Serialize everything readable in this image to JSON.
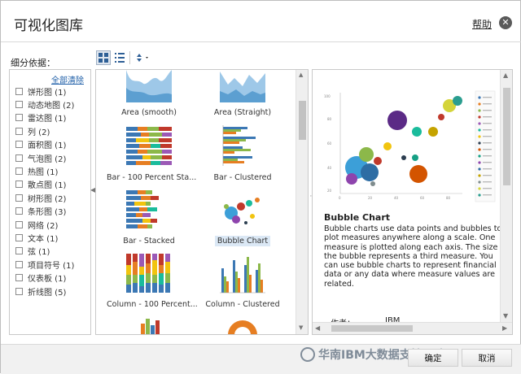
{
  "dialog": {
    "title": "可视化图库",
    "help_label": "帮助",
    "close_icon": "close-icon"
  },
  "filter": {
    "title": "细分依据：",
    "clear_all": "全部清除",
    "items": [
      {
        "label": "饼形图 (1)"
      },
      {
        "label": "动态地图 (2)"
      },
      {
        "label": "雷达图 (1)"
      },
      {
        "label": "列 (2)"
      },
      {
        "label": "面积图 (1)"
      },
      {
        "label": "气泡图 (2)"
      },
      {
        "label": "热图 (1)"
      },
      {
        "label": "散点图 (1)"
      },
      {
        "label": "树形图 (2)"
      },
      {
        "label": "条形图 (3)"
      },
      {
        "label": "网络 (2)"
      },
      {
        "label": "文本 (1)"
      },
      {
        "label": "弦 (1)"
      },
      {
        "label": "项目符号 (1)"
      },
      {
        "label": "仪表板 (1)"
      },
      {
        "label": "折线图 (5)"
      }
    ]
  },
  "toolbar": {
    "grid_icon": "grid-view-icon",
    "list_icon": "list-view-icon",
    "sort_icon": "sort-icon"
  },
  "gallery": {
    "tiles": [
      {
        "label": "Area (smooth)"
      },
      {
        "label": "Area (Straight)"
      },
      {
        "label": "Bar - 100 Percent Sta..."
      },
      {
        "label": "Bar - Clustered"
      },
      {
        "label": "Bar - Stacked"
      },
      {
        "label": "Bubble Chart"
      },
      {
        "label": "Column - 100 Percent..."
      },
      {
        "label": "Column - Clustered"
      }
    ],
    "selected": "Bubble Chart"
  },
  "preview": {
    "title": "Bubble Chart",
    "description": "Bubble charts use data points and bubbles to plot measures anywhere along a scale. One measure is plotted along each axis. The size of the bubble represents a third measure. You can use bubble charts to represent financial data or any data where measure values are related.",
    "author_label": "作者：",
    "author_value": "IBM"
  },
  "footer": {
    "ok_label": "确定",
    "cancel_label": "取消",
    "watermark": "华南IBM大数据支持团队"
  }
}
